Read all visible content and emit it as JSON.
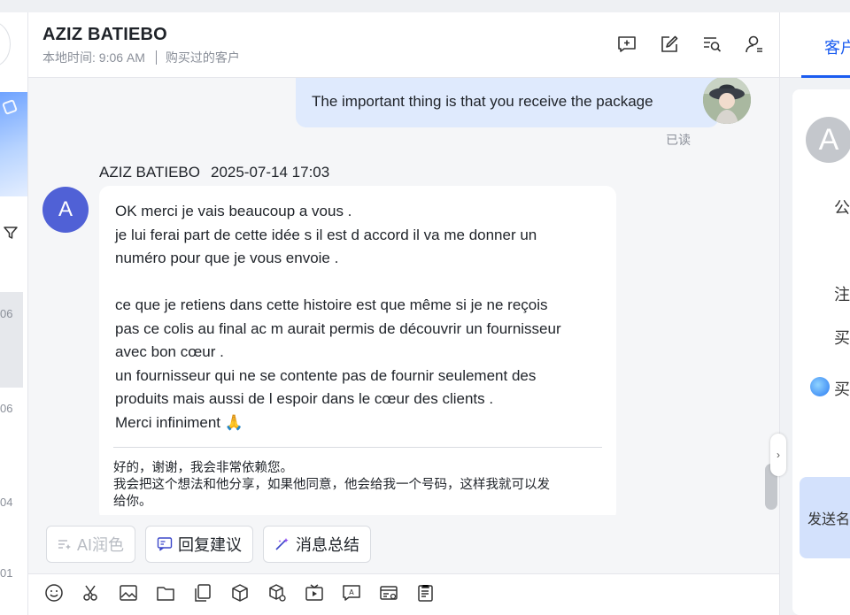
{
  "left_list": {
    "numbers": [
      "06",
      "06",
      "04",
      "01"
    ]
  },
  "chat": {
    "contact_name": "AZIZ BATIEBO",
    "local_time": "本地时间: 9:06 AM",
    "customer_tag": "购买过的客户",
    "header_icons": [
      "quick-reply-icon",
      "edit-icon",
      "search-messages-icon",
      "customer-profile-icon"
    ],
    "outgoing": {
      "text": "The important thing is that you receive the package",
      "status": "已读"
    },
    "incoming": {
      "sender": "AZIZ BATIEBO",
      "timestamp": "2025-07-14 17:03",
      "avatar_letter": "A",
      "lines": [
        "OK merci je vais beaucoup a vous .",
        "je lui ferai part de cette idée s il est d accord il va me donner un",
        "numéro pour que je vous envoie .",
        "",
        "ce que je retiens dans cette histoire est que même si je ne reçois",
        "pas ce colis au final ac m aurait permis de découvrir un fournisseur",
        "avec bon cœur .",
        "un fournisseur qui ne se contente pas de fournir seulement des",
        "produits mais aussi de l espoir dans le cœur des clients .",
        "Merci infiniment 🙏"
      ],
      "translation": [
        "好的，谢谢，我会非常依赖您。",
        "我会把这个想法和他分享，如果他同意，他会给我一个号码，这样我就可以发",
        "给你。"
      ]
    },
    "ai_buttons": {
      "polish": "AI润色",
      "reply_suggestion": "回复建议",
      "summary": "消息总结"
    },
    "toolbar_icons": [
      "emoji-icon",
      "scissors-icon",
      "image-icon",
      "folder-icon",
      "copy-icon",
      "product-icon",
      "package-icon",
      "video-icon",
      "ai-translate-icon",
      "card-icon",
      "template-icon"
    ]
  },
  "right_panel": {
    "tab_label": "客户",
    "avatar_letter": "A",
    "labels": [
      "公",
      "注",
      "买",
      "买"
    ],
    "send_label": "发送名"
  },
  "colors": {
    "accent": "#1b5cf0",
    "outgoing_bubble": "#dfeafd",
    "incoming_avatar": "#5061d6"
  }
}
